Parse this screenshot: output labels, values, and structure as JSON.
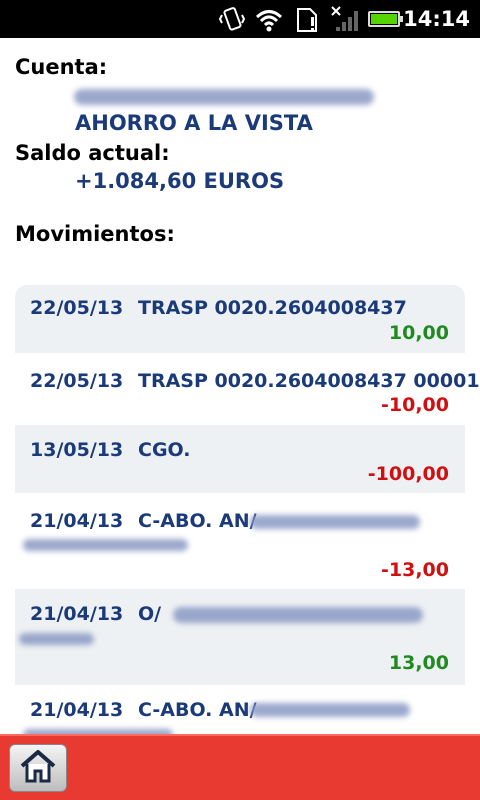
{
  "status_bar": {
    "time": "14:14",
    "icons": [
      "vibrate-icon",
      "wifi-icon",
      "sim-card-icon",
      "no-signal-icon",
      "battery-icon"
    ]
  },
  "account": {
    "cuenta_label": "Cuenta:",
    "account_type": "AHORRO A LA VISTA",
    "saldo_label": "Saldo actual:",
    "saldo_value": "+1.084,60 EUROS",
    "movimientos_label": "Movimientos:"
  },
  "movements": [
    {
      "date": "22/05/13",
      "concept": "TRASP 0020.2604008437",
      "amount": "10,00",
      "sign": "pos"
    },
    {
      "date": "22/05/13",
      "concept": "TRASP 0020.2604008437 00001",
      "amount": "-10,00",
      "sign": "neg"
    },
    {
      "date": "13/05/13",
      "concept": "CGO.",
      "amount": "-100,00",
      "sign": "neg"
    },
    {
      "date": "21/04/13",
      "concept": "C-ABO. AN/",
      "amount": "-13,00",
      "sign": "neg"
    },
    {
      "date": "21/04/13",
      "concept": "O/",
      "amount": "13,00",
      "sign": "pos"
    },
    {
      "date": "21/04/13",
      "concept": "C-ABO. AN/",
      "amount": "",
      "sign": "neg"
    }
  ],
  "colors": {
    "accent_blue": "#1b3a7a",
    "positive": "#1f8a1f",
    "negative": "#d01010",
    "bottom_bar": "#e83a30"
  },
  "bottom_bar": {
    "home_icon": "home-icon"
  }
}
